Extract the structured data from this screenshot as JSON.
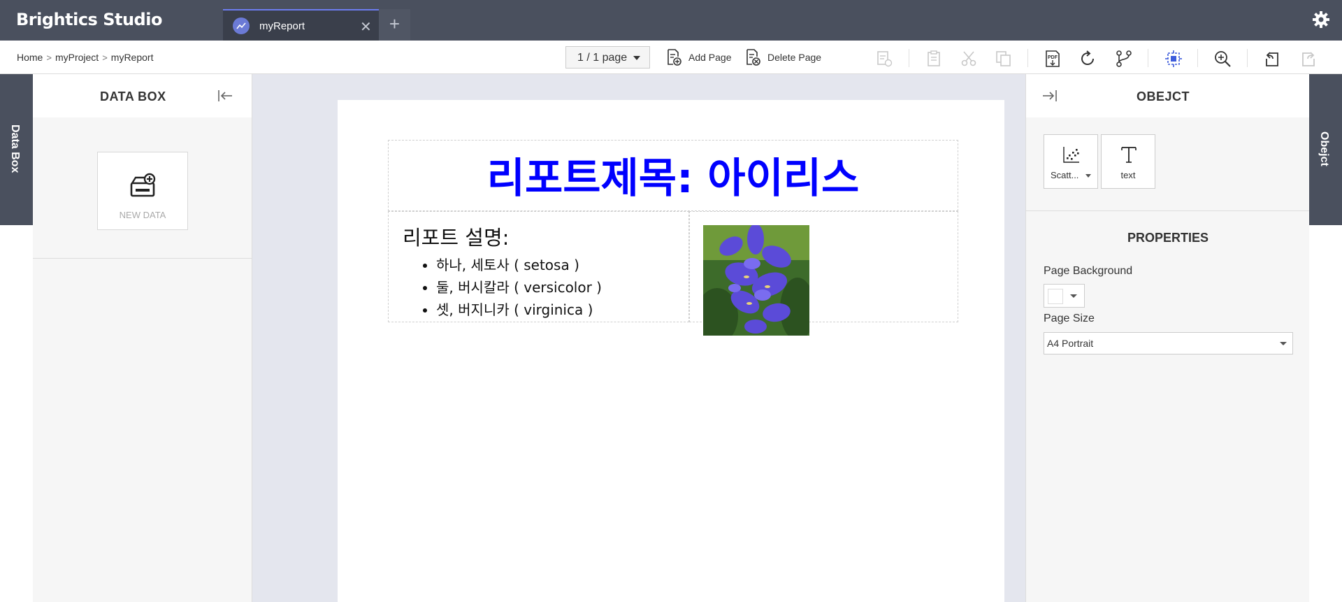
{
  "app": {
    "brand": "Brightics Studio",
    "tab_label": "myReport",
    "tab_add": "+"
  },
  "breadcrumb": [
    "Home",
    "myProject",
    "myReport"
  ],
  "toolbar": {
    "page_selector": "1 / 1 page",
    "add_page": "Add Page",
    "delete_page": "Delete Page"
  },
  "left_strip_label": "Data Box",
  "databox": {
    "title": "DATA BOX",
    "new_data": "NEW DATA"
  },
  "report": {
    "title": "리포트제목: 아이리스",
    "description_heading": "리포트 설명:",
    "items": [
      "하나, 세토사 ( setosa )",
      "둘, 버시칼라 ( versicolor )",
      "셋, 버지니카 ( virginica )"
    ],
    "title_color": "#0000ff"
  },
  "object_panel": {
    "title": "OBEJCT",
    "items": [
      {
        "label": "Scatt...",
        "icon": "scatter-plot-icon"
      },
      {
        "label": "text",
        "icon": "text-icon"
      }
    ]
  },
  "properties": {
    "title": "PROPERTIES",
    "page_background_label": "Page Background",
    "page_background_color": "#ffffff",
    "page_size_label": "Page Size",
    "page_size_value": "A4 Portrait"
  },
  "right_strip_label": "Obejct",
  "colors": {
    "titlebar": "#4a505e",
    "tab_accent": "#6c7df0",
    "canvas": "#e4e6ee",
    "active_icon": "#3d5cdb"
  }
}
